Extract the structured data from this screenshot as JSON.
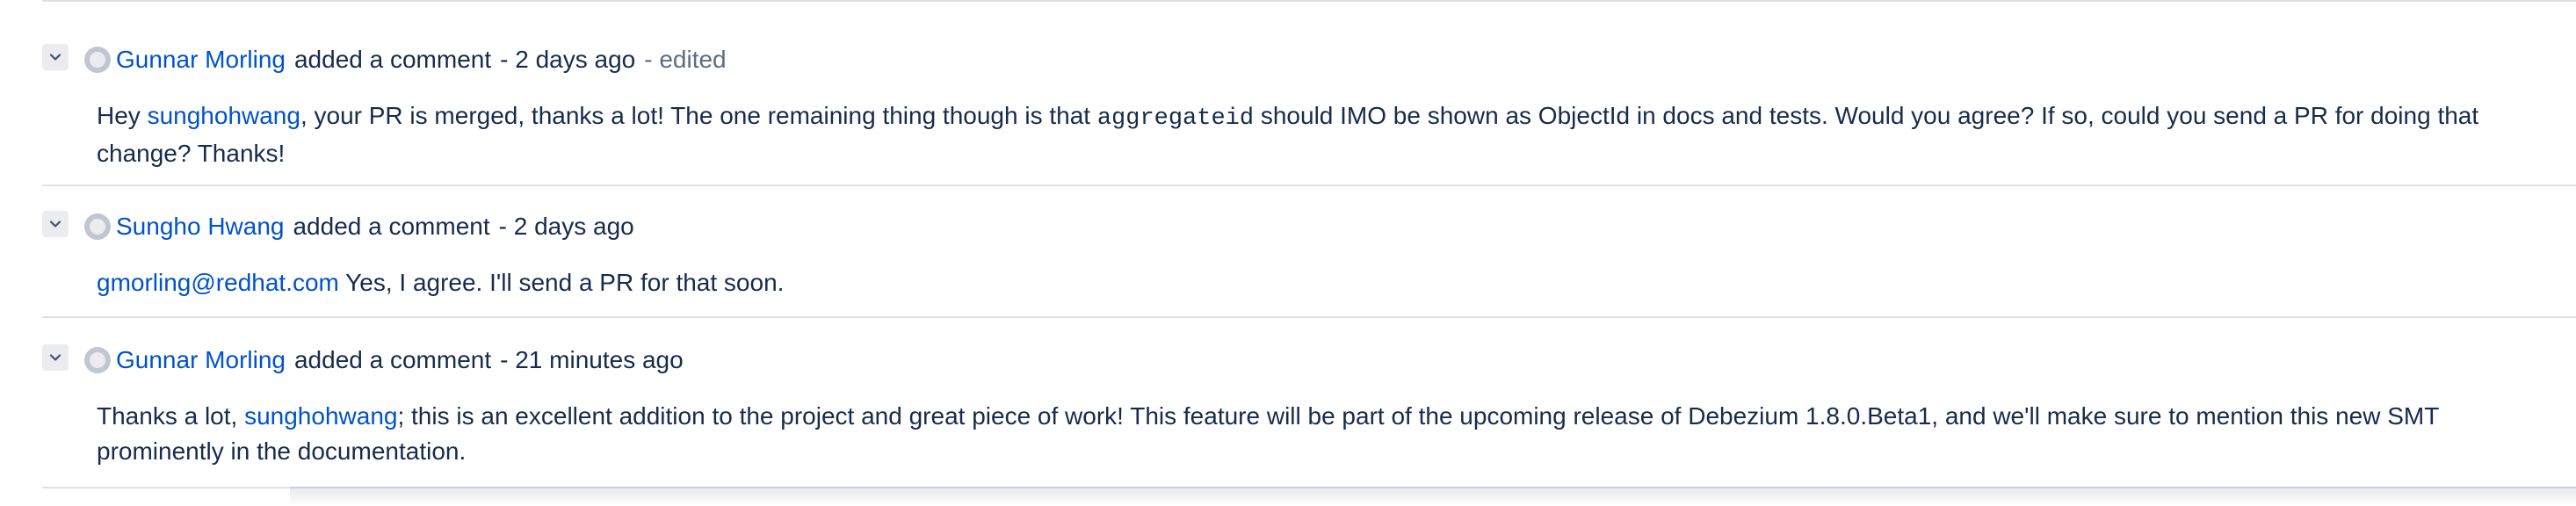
{
  "colors": {
    "link": "#0052cc",
    "text": "#172b4d",
    "muted": "#42526e",
    "divider": "#dfe1e6"
  },
  "comments": [
    {
      "author": "Gunnar Morling",
      "action": "added a comment",
      "time": "- 2 days ago",
      "edited": "- edited",
      "body": {
        "p1": "Hey ",
        "mention": "sunghohwang",
        "p2": ", your PR is merged, thanks a lot! The one remaining thing though is that ",
        "code": "aggregateid",
        "p3": " should IMO be shown as ObjectId in docs and tests. Would you agree? If so, could you send a PR for doing that change? Thanks!"
      }
    },
    {
      "author": "Sungho Hwang",
      "action": "added a comment",
      "time": "- 2 days ago",
      "body": {
        "email": "gmorling@redhat.com",
        "text": " Yes, I agree. I'll send a PR for that soon."
      }
    },
    {
      "author": "Gunnar Morling",
      "action": "added a comment",
      "time": "- 21 minutes ago",
      "body": {
        "p1": "Thanks a lot, ",
        "mention": "sunghohwang",
        "p2": "; this is an excellent addition to the project and great piece of work! This feature will be part of the upcoming release of Debezium 1.8.0.Beta1, and we'll make sure to mention this new SMT prominently in the documentation."
      }
    }
  ],
  "icons": {
    "toggle": "chevron-down-icon",
    "avatar": "user-avatar-icon"
  }
}
